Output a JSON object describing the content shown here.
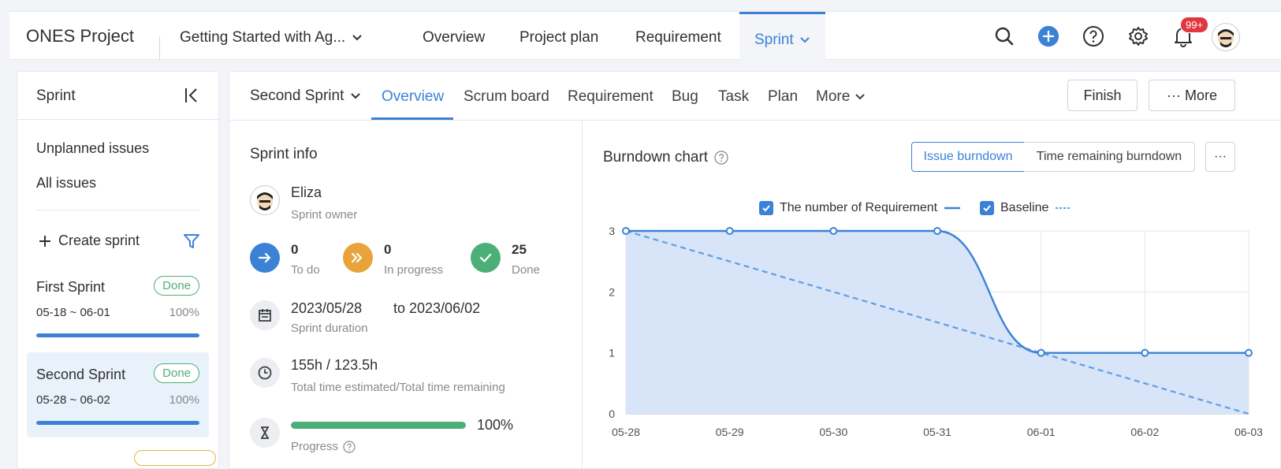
{
  "topbar": {
    "app_title": "ONES Project",
    "project": "Getting Started with Ag...",
    "tabs": [
      "Overview",
      "Project plan",
      "Requirement"
    ],
    "active_tab": "Sprint",
    "notification_badge": "99+",
    "icons": [
      "search-icon",
      "add-icon",
      "help-icon",
      "settings-icon",
      "bell-icon",
      "avatar"
    ]
  },
  "sidebar": {
    "title": "Sprint",
    "links": [
      "Unplanned issues",
      "All issues"
    ],
    "create_label": "Create sprint",
    "sprints": [
      {
        "name": "First Sprint",
        "status": "Done",
        "dates": "05-18 ~ 06-01",
        "percent": "100%",
        "progress": 1.0
      },
      {
        "name": "Second Sprint",
        "status": "Done",
        "dates": "05-28 ~ 06-02",
        "percent": "100%",
        "progress": 1.0
      }
    ]
  },
  "subnav": {
    "sprint": "Second Sprint",
    "tabs": [
      "Overview",
      "Scrum board",
      "Requirement",
      "Bug",
      "Task",
      "Plan"
    ],
    "more_label": "More",
    "finish_button": "Finish",
    "more_button": "··· More"
  },
  "sprint_info": {
    "title": "Sprint info",
    "owner_name": "Eliza",
    "owner_label": "Sprint owner",
    "stats": [
      {
        "value": "0",
        "label": "To do",
        "color": "#3b82d6"
      },
      {
        "value": "0",
        "label": "In progress",
        "color": "#e8a43a"
      },
      {
        "value": "25",
        "label": "Done",
        "color": "#4caf78"
      }
    ],
    "start_date": "2023/05/28",
    "end_date": "to 2023/06/02",
    "duration_label": "Sprint duration",
    "time_value": "155h / 123.5h",
    "time_label": "Total time estimated/Total time remaining",
    "progress_percent": "100%",
    "progress_value": 1.0,
    "progress_label": "Progress"
  },
  "burndown": {
    "title": "Burndown chart",
    "toggle_active": "Issue burndown",
    "toggle_other": "Time remaining burndown",
    "more": "···",
    "legend_series": "The number of Requirement",
    "legend_baseline": "Baseline"
  },
  "chart_data": {
    "type": "line",
    "categories": [
      "05-28",
      "05-29",
      "05-30",
      "05-31",
      "06-01",
      "06-02",
      "06-03"
    ],
    "series": [
      {
        "name": "The number of Requirement",
        "values": [
          3,
          3,
          3,
          3,
          1,
          1,
          1
        ]
      },
      {
        "name": "Baseline",
        "values": [
          3,
          2.5,
          2,
          1.5,
          1,
          0.5,
          0
        ]
      }
    ],
    "ylim": [
      0,
      3
    ],
    "yticks": [
      "0",
      "1",
      "2",
      "3"
    ],
    "grid": true,
    "legend_position": "top-center",
    "colors": {
      "series": "#3b82d6",
      "fill": "#d8e4f7",
      "baseline": "#5aa0e6"
    }
  }
}
